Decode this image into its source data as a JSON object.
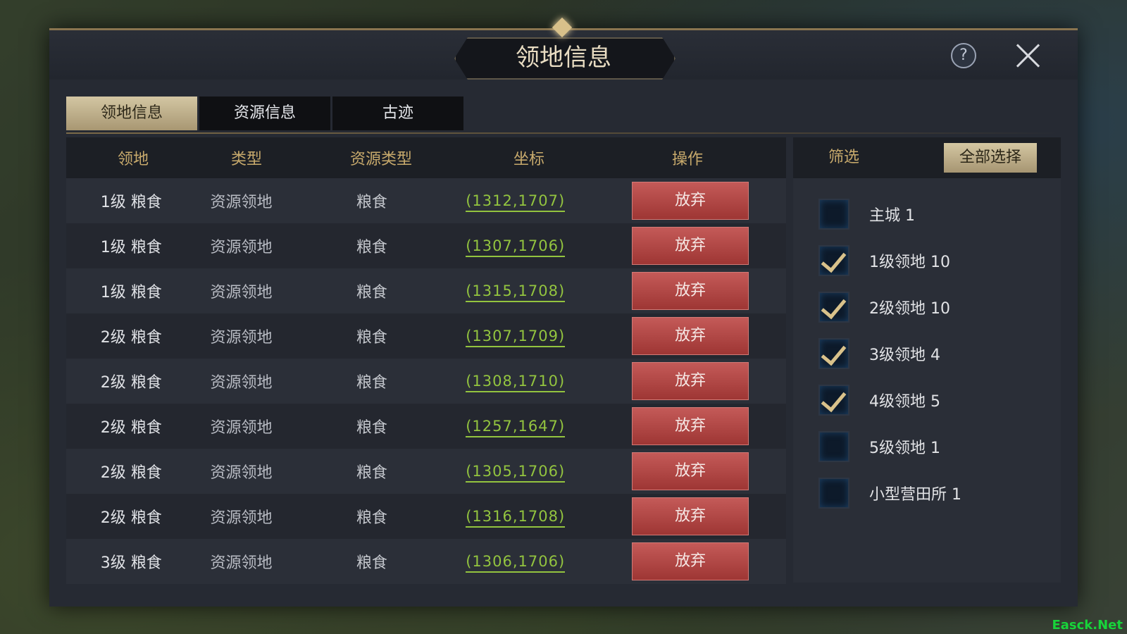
{
  "dialog": {
    "title": "领地信息",
    "help_icon": "?",
    "close_icon": "close-icon"
  },
  "tabs": [
    {
      "label": "领地信息",
      "active": true
    },
    {
      "label": "资源信息",
      "active": false
    },
    {
      "label": "古迹",
      "active": false
    }
  ],
  "table": {
    "headers": [
      "领地",
      "类型",
      "资源类型",
      "坐标",
      "操作"
    ],
    "rows": [
      {
        "land": "1级  粮食",
        "type": "资源领地",
        "resource": "粮食",
        "coord": "(1312,1707)",
        "action": "放弃"
      },
      {
        "land": "1级  粮食",
        "type": "资源领地",
        "resource": "粮食",
        "coord": "(1307,1706)",
        "action": "放弃"
      },
      {
        "land": "1级  粮食",
        "type": "资源领地",
        "resource": "粮食",
        "coord": "(1315,1708)",
        "action": "放弃"
      },
      {
        "land": "2级  粮食",
        "type": "资源领地",
        "resource": "粮食",
        "coord": "(1307,1709)",
        "action": "放弃"
      },
      {
        "land": "2级  粮食",
        "type": "资源领地",
        "resource": "粮食",
        "coord": "(1308,1710)",
        "action": "放弃"
      },
      {
        "land": "2级  粮食",
        "type": "资源领地",
        "resource": "粮食",
        "coord": "(1257,1647)",
        "action": "放弃"
      },
      {
        "land": "2级  粮食",
        "type": "资源领地",
        "resource": "粮食",
        "coord": "(1305,1706)",
        "action": "放弃"
      },
      {
        "land": "2级  粮食",
        "type": "资源领地",
        "resource": "粮食",
        "coord": "(1316,1708)",
        "action": "放弃"
      },
      {
        "land": "3级  粮食",
        "type": "资源领地",
        "resource": "粮食",
        "coord": "(1306,1706)",
        "action": "放弃"
      }
    ]
  },
  "filter": {
    "title": "筛选",
    "select_all": "全部选择",
    "items": [
      {
        "label": "主城  1",
        "checked": false
      },
      {
        "label": "1级领地  10",
        "checked": true
      },
      {
        "label": "2级领地  10",
        "checked": true
      },
      {
        "label": "3级领地  4",
        "checked": true
      },
      {
        "label": "4级领地  5",
        "checked": true
      },
      {
        "label": "5级领地  1",
        "checked": false
      },
      {
        "label": "小型营田所  1",
        "checked": false
      }
    ]
  },
  "colors": {
    "accent_gold": "#c8aa6c",
    "coord_green": "#93c43f",
    "abandon_red": "#b44846"
  },
  "watermark": "Easck.Net"
}
